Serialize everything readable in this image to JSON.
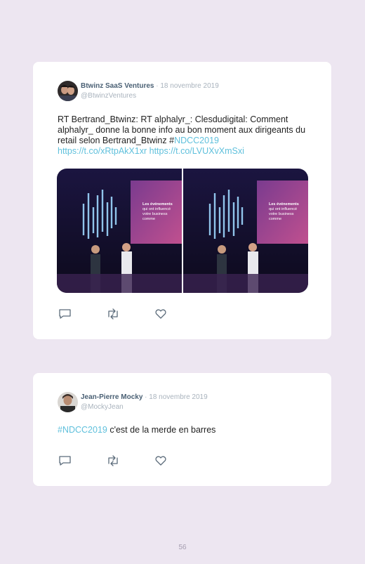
{
  "tweets": [
    {
      "author_name": "Btwinz SaaS Ventures",
      "date": " · 18 novembre 2019",
      "handle": "@BtwinzVentures",
      "text_plain_1": "RT Bertrand_Btwinz: RT alphalyr_: Clesdudigital: Comment alphalyr_ donne la bonne info au bon moment aux dirigeants du retail selon Bertrand_Btwinz #",
      "hashtag": "NDCC2019",
      "link_1": "https://t.co/xRtpAkX1xr",
      "link_2": "https://t.co/LVUXvXmSxi",
      "media_caption": [
        "Les événements",
        "qui ont influencé",
        "votre business",
        "comme"
      ]
    },
    {
      "author_name": "Jean-Pierre Mocky",
      "date": " · 18 novembre 2019",
      "handle": "@MockyJean",
      "hashtag": "#NDCC2019",
      "text_plain": " c'est de la merde en barres"
    }
  ],
  "icons": [
    "reply-icon",
    "retweet-icon",
    "like-icon"
  ],
  "colors": {
    "background": "#ede6f1",
    "link": "#5fc0dc",
    "name": "#4a6074",
    "muted": "#a9b3bd"
  },
  "page_number": "56"
}
